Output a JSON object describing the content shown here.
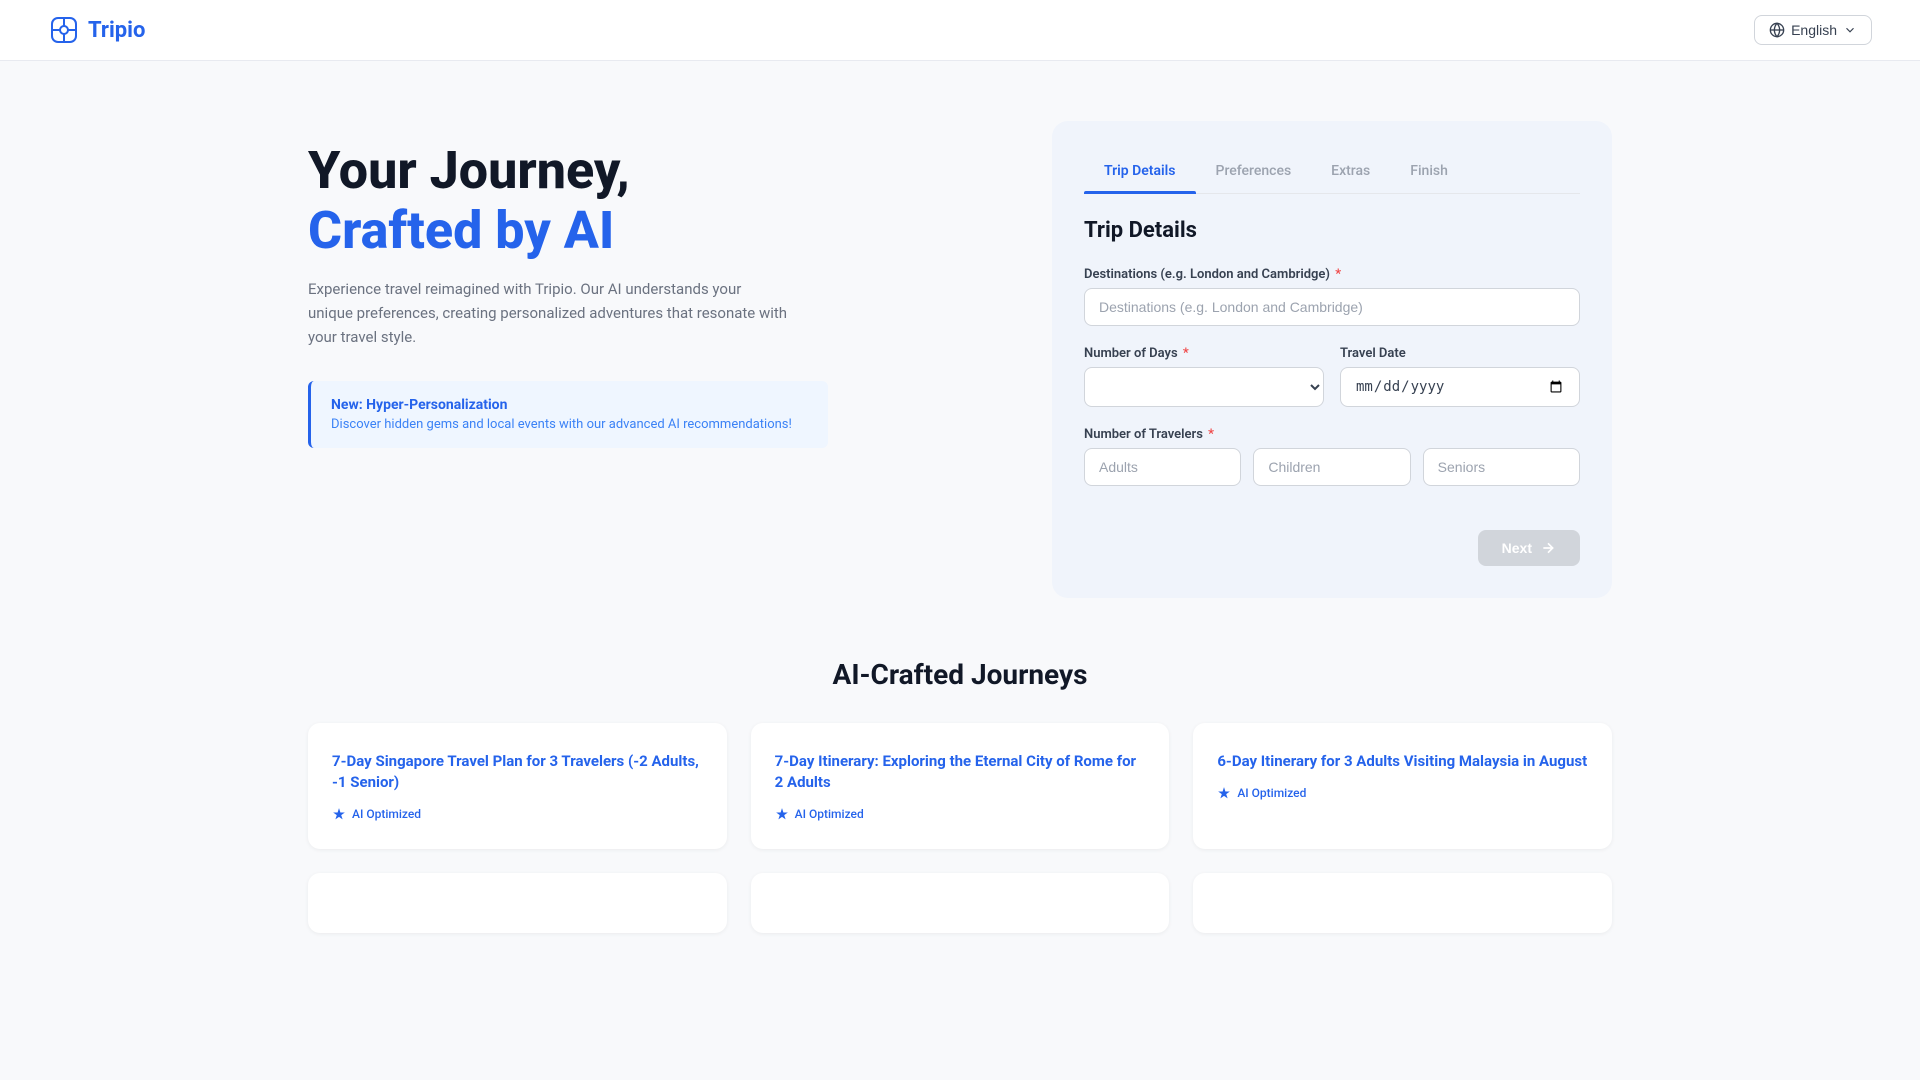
{
  "header": {
    "logo": "Tripio",
    "language": "English"
  },
  "hero": {
    "title_line1": "Your Journey,",
    "title_line2": "Crafted by AI",
    "subtitle": "Experience travel reimagined with Tripio. Our AI understands your unique preferences, creating personalized adventures that resonate with your travel style.",
    "highlight_title": "New: Hyper-Personalization",
    "highlight_desc": "Discover hidden gems and local events with our advanced AI recommendations!"
  },
  "tabs": [
    {
      "id": "trip-details",
      "label": "Trip Details",
      "active": true
    },
    {
      "id": "preferences",
      "label": "Preferences",
      "active": false
    },
    {
      "id": "extras",
      "label": "Extras",
      "active": false
    },
    {
      "id": "finish",
      "label": "Finish",
      "active": false
    }
  ],
  "form": {
    "title": "Trip Details",
    "destinations_label": "Destinations (e.g. London and Cambridge)",
    "destinations_placeholder": "Destinations (e.g. London and Cambridge)",
    "days_label": "Number of Days",
    "travel_date_label": "Travel Date",
    "travel_date_placeholder": "mm/dd/yyyy",
    "travelers_label": "Number of Travelers",
    "adults_placeholder": "Adults",
    "children_placeholder": "Children",
    "seniors_placeholder": "Seniors",
    "next_label": "Next"
  },
  "journeys_section": {
    "title": "AI-Crafted Journeys",
    "cards": [
      {
        "title": "7-Day Singapore Travel Plan for 3 Travelers (-2 Adults, -1 Senior)",
        "badge": "AI Optimized"
      },
      {
        "title": "7-Day Itinerary: Exploring the Eternal City of Rome for 2 Adults",
        "badge": "AI Optimized"
      },
      {
        "title": "6-Day Itinerary for 3 Adults Visiting Malaysia in August",
        "badge": "AI Optimized"
      }
    ],
    "partial_cards": [
      {
        "title": ""
      },
      {
        "title": ""
      },
      {
        "title": ""
      }
    ]
  }
}
